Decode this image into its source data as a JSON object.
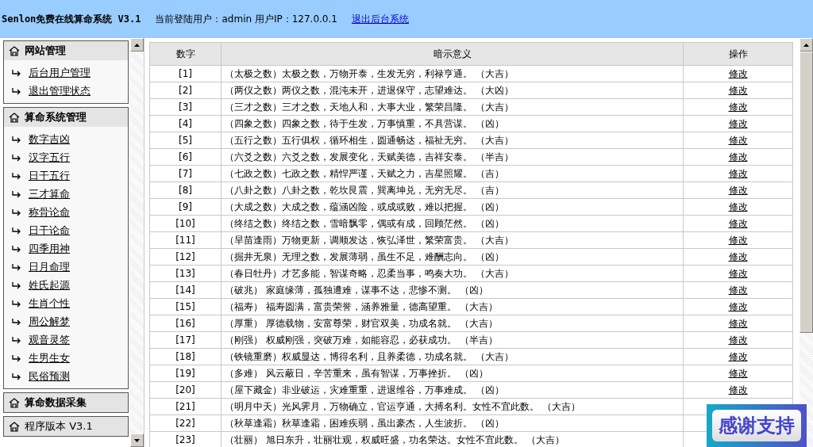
{
  "header": {
    "title": "Senlon免费在线算命系统 V3.1",
    "user_info": "当前登陆用户：admin 用户IP：127.0.0.1",
    "logout_link": "退出后台系统"
  },
  "sidebar": {
    "sections": [
      {
        "title": "网站管理",
        "kind": "group",
        "items": [
          "后台用户管理",
          "退出管理状态"
        ]
      },
      {
        "title": "算命系统管理",
        "kind": "group",
        "items": [
          "数字吉凶",
          "汉字五行",
          "日干五行",
          "三才算命",
          "称骨论命",
          "日干论命",
          "四季用神",
          "日月命理",
          "姓氏起源",
          "生肖个性",
          "周公解梦",
          "观音灵签",
          "生男生女",
          "民俗预测"
        ]
      },
      {
        "title": "算命数据采集",
        "kind": "group"
      },
      {
        "title": "程序版本 V3.1",
        "kind": "info"
      }
    ]
  },
  "table": {
    "columns": [
      "数字",
      "暗示意义",
      "操作"
    ],
    "rows": [
      {
        "number": "[1]",
        "meaning": "（太极之数）太极之数，万物开泰，生发无穷，利禄亨通。 （大吉）",
        "action": "修改"
      },
      {
        "number": "[2]",
        "meaning": "（两仪之数）两仪之数，混沌未开，进退保守，志望难达。 （大凶）",
        "action": "修改"
      },
      {
        "number": "[3]",
        "meaning": "（三才之数）三才之数，天地人和，大事大业，繁荣昌隆。   （大吉）",
        "action": "修改"
      },
      {
        "number": "[4]",
        "meaning": "（四象之数）四象之数，待于生发，万事慎重，不具营谋。 （凶）",
        "action": "修改"
      },
      {
        "number": "[5]",
        "meaning": "（五行之数）五行俱权，循环相生，圆通畅达，福祉无穷。 （大吉）",
        "action": "修改"
      },
      {
        "number": "[6]",
        "meaning": "（六爻之数）六爻之数，发展变化，天赋美德，吉祥安泰。   （半吉）",
        "action": "修改"
      },
      {
        "number": "[7]",
        "meaning": "（七政之数）七政之数，精悍严谨，天赋之力，吉星照耀。   （吉）",
        "action": "修改"
      },
      {
        "number": "[8]",
        "meaning": "（八卦之数）八卦之数，乾坎艮震，巽离坤兑，无穷无尽。   （吉）",
        "action": "修改"
      },
      {
        "number": "[9]",
        "meaning": "（大成之数）大成之数，蕴涵凶险，或成或败，难以把握。 （凶）",
        "action": "修改"
      },
      {
        "number": "[10]",
        "meaning": "（终结之数）终结之数，雪暗飘零，偶或有成，回顾茫然。   （凶）",
        "action": "修改"
      },
      {
        "number": "[11]",
        "meaning": "（旱苗逢雨）万物更新，调顺发达，恢弘泽世，繁荣富贵。   （大吉）",
        "action": "修改"
      },
      {
        "number": "[12]",
        "meaning": "（掘井无泉）无理之数，发展薄弱，虽生不足，难酬志向。 （凶）",
        "action": "修改"
      },
      {
        "number": "[13]",
        "meaning": "（春日牡丹）才艺多能，智谋奇略，忍柔当事，鸣奏大功。 （大吉）",
        "action": "修改"
      },
      {
        "number": "[14]",
        "meaning": "（破兆） 家庭缘薄，孤独遭难，谋事不达，悲惨不测。 （凶）",
        "action": "修改"
      },
      {
        "number": "[15]",
        "meaning": "（福寿） 福寿圆满，富贵荣誉，涵养雅量，德高望重。 （大吉）",
        "action": "修改"
      },
      {
        "number": "[16]",
        "meaning": "（厚重） 厚德载物，安富尊荣，财官双美，功成名就。 （大吉）",
        "action": "修改"
      },
      {
        "number": "[17]",
        "meaning": "（刚强） 权威刚强，突破万难，如能容忍，必获成功。   （半吉）",
        "action": "修改"
      },
      {
        "number": "[18]",
        "meaning": "（铁镜重磨）权威显达，博得名利，且养柔德，功成名就。 （大吉）",
        "action": "修改"
      },
      {
        "number": "[19]",
        "meaning": "（多难） 风云蔽日，辛苦重来，虽有智谋，万事挫折。 （凶）",
        "action": "修改"
      },
      {
        "number": "[20]",
        "meaning": "（屋下藏金）非业破运，灾难重重，进退维谷，万事难成。 （凶）",
        "action": "修改"
      },
      {
        "number": "[21]",
        "meaning": "（明月中天）光风霁月，万物确立，官运亨通，大搏名利。女性不宜此数。   （大吉）"
      },
      {
        "number": "[22]",
        "meaning": "（秋草逢霜）秋草逢霜，困难疾弱，虽出豪杰，人生波折。 （凶）"
      },
      {
        "number": "[23]",
        "meaning": "（壮丽） 旭日东升，壮丽壮观，权威旺盛，功名荣达。女性不宜此数。 （大吉）"
      }
    ]
  },
  "support_badge": "感谢支持"
}
